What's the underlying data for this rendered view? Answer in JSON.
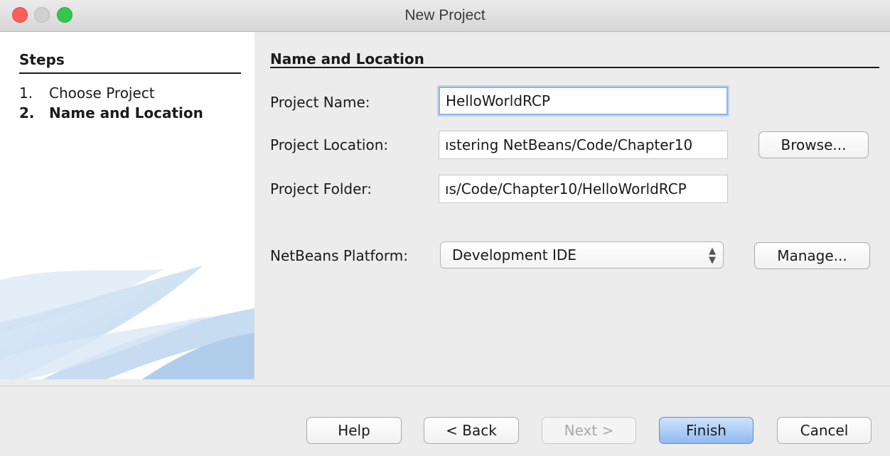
{
  "window": {
    "title": "New Project"
  },
  "steps": {
    "title": "Steps",
    "items": [
      {
        "num": "1.",
        "label": "Choose Project",
        "active": false
      },
      {
        "num": "2.",
        "label": "Name and Location",
        "active": true
      }
    ]
  },
  "main": {
    "section_title": "Name and Location",
    "project_name": {
      "label": "Project Name:",
      "value": "HelloWorldRCP"
    },
    "project_location": {
      "label": "Project Location:",
      "value": "ıstering NetBeans/Code/Chapter10"
    },
    "project_folder": {
      "label": "Project Folder:",
      "value": "ıs/Code/Chapter10/HelloWorldRCP"
    },
    "platform": {
      "label": "NetBeans Platform:",
      "selected": "Development IDE"
    },
    "browse_label": "Browse...",
    "manage_label": "Manage..."
  },
  "footer": {
    "help_label": "Help",
    "back_label": "< Back",
    "next_label": "Next >",
    "finish_label": "Finish",
    "cancel_label": "Cancel"
  },
  "colors": {
    "close": "#fc5f57",
    "minimize": "#d0d0d0",
    "maximize": "#34c84a",
    "focus_ring": "#8fb5e8",
    "default_button": "#8fbaf1"
  },
  "icons": [
    "window-close-icon",
    "window-minimize-icon",
    "window-maximize-icon",
    "select-arrows-icon",
    "netbeans-swoosh-graphic"
  ]
}
